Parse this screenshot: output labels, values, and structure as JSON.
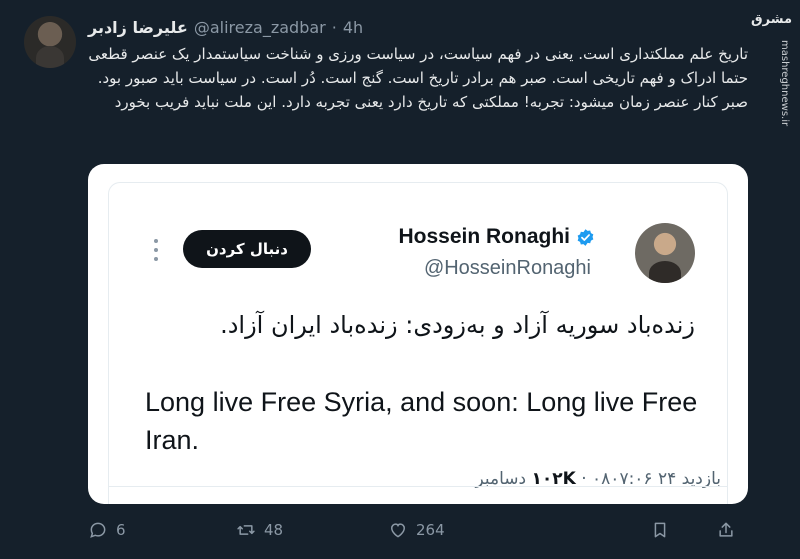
{
  "author": {
    "name": "علیرضا زادبر",
    "handle": "@alireza_zadbar",
    "separator": "·",
    "time": "4h"
  },
  "watermark": {
    "logo": "مشرق",
    "url": "mashreghnews.ir"
  },
  "tweet": {
    "text": "تاریخ علم مملکتداری است. یعنی در فهم سیاست، در سیاست ورزی و شناخت سیاستمدار یک عنصر قطعی حتما ادراک و فهم تاریخی است. صبر هم برادر تاریخ است. گنج است. دُر است. در سیاست باید صبور بود. صبر کنار عنصر زمان میشود: تجربه! مملکتی که تاریخ دارد یعنی تجربه دارد. این ملت نباید فریب بخورد"
  },
  "quoted": {
    "name": "Hossein Ronaghi",
    "handle": "@HosseinRonaghi",
    "follow_label": "دنبال کردن",
    "text_persian": "زنده‌باد سوریه آزاد و به‌زودی: زنده‌باد ایران آزاد.",
    "text_english": "Long live Free Syria, and soon: Long live Free Iran.",
    "meta_time": "۰۸۰۷:۰۶ ۲۴ دسامبر",
    "meta_views_label": "بازدید",
    "meta_views_count": "۱۰۲K"
  },
  "actions": {
    "replies": "6",
    "retweets": "48",
    "likes": "264"
  },
  "colors": {
    "background": "#15202b",
    "card": "#ffffff",
    "verified": "#1d9bf0",
    "muted": "#8b98a5"
  }
}
